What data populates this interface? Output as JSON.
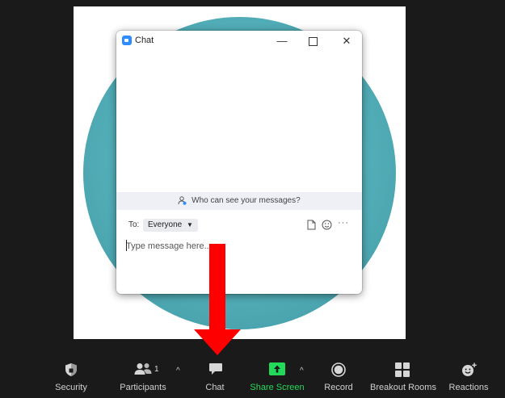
{
  "chat_window": {
    "title": "Chat",
    "minimize": "—",
    "close": "✕",
    "notice": "Who can see your messages?",
    "to_label": "To:",
    "recipient": "Everyone",
    "more": "···",
    "input_placeholder": "Type message here..."
  },
  "toolbar": {
    "security": "Security",
    "participants": "Participants",
    "participant_count": "1",
    "chat": "Chat",
    "share_screen": "Share Screen",
    "record": "Record",
    "breakout_rooms": "Breakout Rooms",
    "reactions": "Reactions",
    "chevron": "^"
  },
  "colors": {
    "accent": "#2d8cff",
    "share_green": "#23d959",
    "arrow_red": "#ff0000",
    "circle_teal": "#52aeb8"
  }
}
